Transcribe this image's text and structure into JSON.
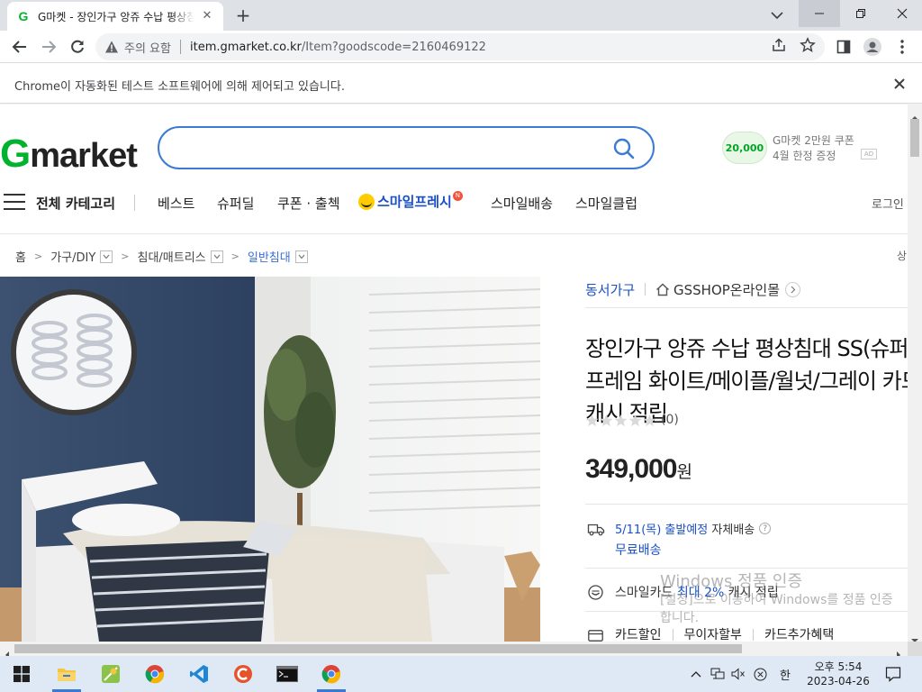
{
  "browser": {
    "tab_title": "G마켓 - 장인가구 앙쥬 수납 평상침대 SS(슈퍼싱글) 프레임 화이트/메이플/월넛/그레이 카드할인 캐시 적립",
    "security_label": "주의 요함",
    "url_host": "item.gmarket.co.kr",
    "url_path": "/Item?goodscode=2160469122",
    "infobar_text": "Chrome이 자동화된 테스트 소프트웨어에 의해 제어되고 있습니다."
  },
  "header": {
    "logo_g": "G",
    "logo_rest": "market",
    "search_placeholder": "",
    "ad_coupon": "20,000",
    "ad_line1": "G마켓 2만원 쿠폰",
    "ad_line2": "4월 한정 증정",
    "ad_badge": "AD"
  },
  "nav": {
    "all_categories": "전체 카테고리",
    "items": [
      "베스트",
      "슈퍼딜",
      "쿠폰 · 출첵"
    ],
    "smile_fresh": "스마일프레시",
    "new_badge": "N",
    "items2": [
      "스마일배송",
      "스마일클럽"
    ],
    "login": "로그인"
  },
  "breadcrumb": {
    "home": "홈",
    "levels": [
      "가구/DIY",
      "침대/매트리스",
      "일반침대"
    ],
    "right": "상"
  },
  "product": {
    "seller": "동서가구",
    "shop": "GSSHOP온라인몰",
    "title": "장인가구 앙쥬 수납 평상침대 SS(슈퍼싱글) 프레임 화이트/메이플/월넛/그레이 카드할인 캐시 적립",
    "review_count": "(0)",
    "rating": 0,
    "price": "349,000",
    "price_unit": "원",
    "shipping_date": "5/11(목) 출발예정",
    "shipping_method": "자체배송",
    "shipping_fee": "무료배송",
    "smilecard_prefix": "스마일카드",
    "smilecard_highlight": "최대 2%",
    "smilecard_suffix": "캐시 적립",
    "card_options": [
      "카드할인",
      "무이자할부",
      "카드추가혜택"
    ]
  },
  "watermark": {
    "line1": "Windows 정품 인증",
    "line2": "[설정]으로 이동하여 Windows를 정품 인증합니다."
  },
  "taskbar": {
    "time": "오후 5:54",
    "date": "2023-04-26",
    "ime": "한"
  },
  "colors": {
    "gmarket_green": "#00b22d",
    "gmarket_blue": "#1a50c7",
    "search_border": "#3a7bd5"
  }
}
